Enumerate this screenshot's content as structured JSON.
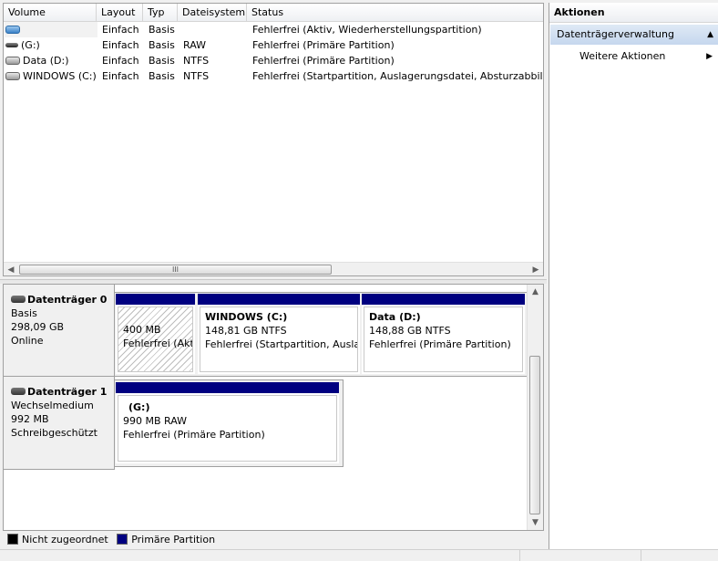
{
  "volume_list": {
    "columns": [
      "Volume",
      "Layout",
      "Typ",
      "Dateisystem",
      "Status"
    ],
    "rows": [
      {
        "volume": "",
        "icon": "blue-drive-icon",
        "layout": "Einfach",
        "typ": "Basis",
        "dateisystem": "",
        "status": "Fehlerfrei (Aktiv, Wiederherstellungspartition)"
      },
      {
        "volume": "(G:)",
        "icon": "removable-drive-icon",
        "layout": "Einfach",
        "typ": "Basis",
        "dateisystem": "RAW",
        "status": "Fehlerfrei (Primäre Partition)"
      },
      {
        "volume": "Data (D:)",
        "icon": "drive-icon",
        "layout": "Einfach",
        "typ": "Basis",
        "dateisystem": "NTFS",
        "status": "Fehlerfrei (Primäre Partition)"
      },
      {
        "volume": "WINDOWS (C:)",
        "icon": "drive-icon",
        "layout": "Einfach",
        "typ": "Basis",
        "dateisystem": "NTFS",
        "status": "Fehlerfrei (Startpartition, Auslagerungsdatei, Absturzabbild, P"
      }
    ],
    "scroll_grip": "III"
  },
  "disks": [
    {
      "title": "Datenträger 0",
      "type": "Basis",
      "size": "298,09 GB",
      "state": "Online",
      "partitions": [
        {
          "name": "",
          "line1": "400 MB",
          "line2": "Fehlerfrei (Akt",
          "hatched": true
        },
        {
          "name": "WINDOWS  (C:)",
          "line1": "148,81 GB NTFS",
          "line2": "Fehlerfrei (Startpartition, Auslag",
          "hatched": false
        },
        {
          "name": "Data  (D:)",
          "line1": "148,88 GB NTFS",
          "line2": "Fehlerfrei (Primäre Partition)",
          "hatched": false
        }
      ]
    },
    {
      "title": "Datenträger 1",
      "type": "Wechselmedium",
      "size": "992 MB",
      "state": "Schreibgeschützt",
      "partitions": [
        {
          "name": "(G:)",
          "line1": "990 MB RAW",
          "line2": "Fehlerfrei (Primäre Partition)",
          "hatched": false
        }
      ]
    }
  ],
  "legend": {
    "items": [
      {
        "label": "Nicht zugeordnet",
        "color": "#000000"
      },
      {
        "label": "Primäre Partition",
        "color": "#000080"
      }
    ]
  },
  "actions": {
    "header": "Aktionen",
    "group": "Datenträgerverwaltung",
    "item": "Weitere Aktionen"
  },
  "colors": {
    "partition_bar": "#000080",
    "selection": "#c5d7ee"
  }
}
